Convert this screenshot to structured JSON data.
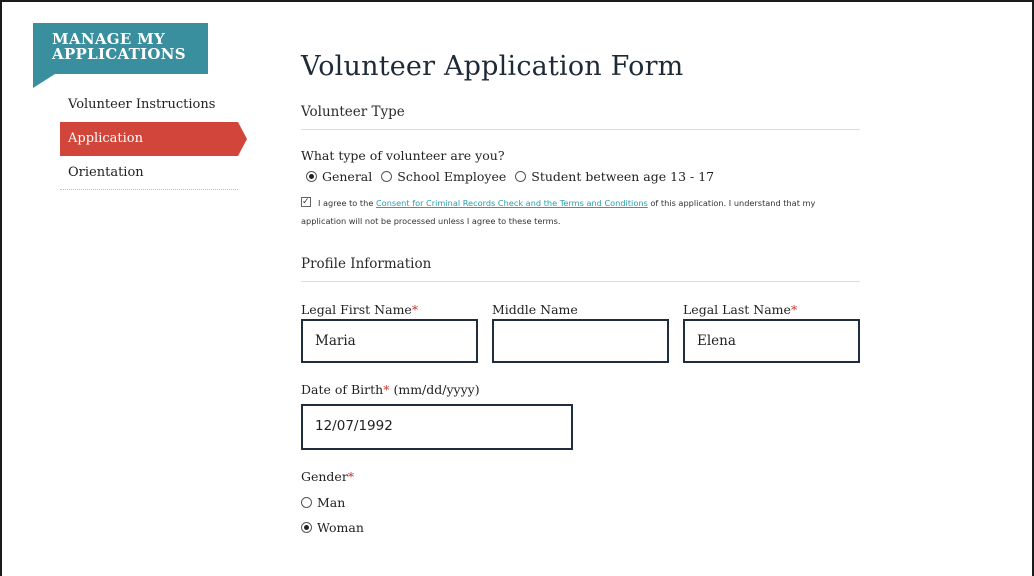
{
  "sidebar": {
    "banner_line1": "MANAGE MY",
    "banner_line2": "APPLICATIONS",
    "items": [
      {
        "label": "Volunteer Instructions"
      },
      {
        "label": "Application"
      },
      {
        "label": "Orientation"
      }
    ]
  },
  "form": {
    "title": "Volunteer Application Form",
    "volunteer_type": {
      "section_title": "Volunteer Type",
      "question": "What type of volunteer are you?",
      "options": [
        "General",
        "School Employee",
        "Student between age 13 - 17"
      ],
      "selected": "General"
    },
    "agreement": {
      "checked": true,
      "prefix": "I agree to the ",
      "link_text": "Consent for Criminal Records Check and the Terms and Conditions",
      "suffix": " of this application. I understand that my",
      "line2": "application will not be processed unless I agree to these terms."
    },
    "profile": {
      "section_title": "Profile Information",
      "first_name_label": "Legal First Name",
      "first_name_value": "Maria",
      "middle_name_label": "Middle Name",
      "middle_name_value": "",
      "last_name_label": "Legal Last Name",
      "last_name_value": "Elena",
      "dob_label": "Date of Birth",
      "dob_format": " (mm/dd/yyyy)",
      "dob_value": "12/07/1992",
      "gender_label": "Gender",
      "gender_options": [
        "Man",
        "Woman"
      ],
      "gender_selected": "Woman",
      "required_marker": "*"
    }
  },
  "colors": {
    "banner": "#3a8f9f",
    "active_nav": "#d2453a",
    "link": "#2a9fa8",
    "required": "#c43a33",
    "input_border": "#1f2d3d"
  }
}
